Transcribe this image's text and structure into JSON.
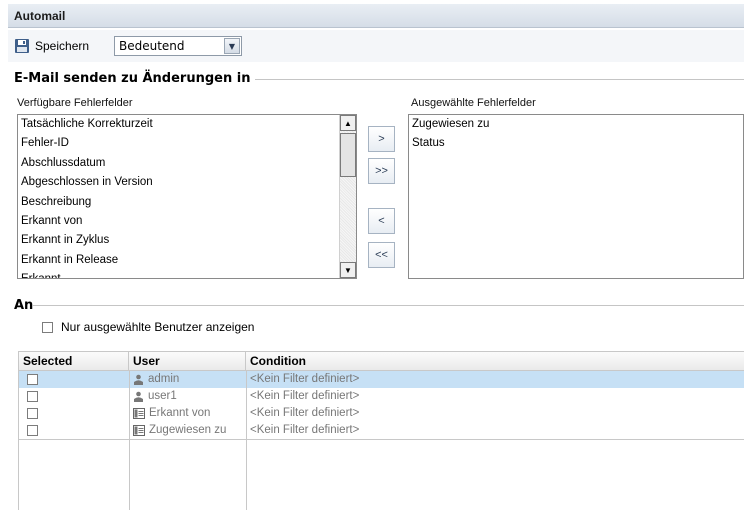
{
  "window": {
    "title": "Automail"
  },
  "toolbar": {
    "save_label": "Speichern",
    "save_icon": "floppy-disk-icon",
    "importance_select": {
      "selected": "Bedeutend"
    }
  },
  "send_section": {
    "title": "E-Mail senden zu Änderungen  in",
    "available_label": "Verfügbare Fehlerfelder",
    "available_fields": [
      "Tatsächliche Korrekturzeit",
      "Fehler-ID",
      "Abschlussdatum",
      "Abgeschlossen in Version",
      "Beschreibung",
      "Erkannt von",
      "Erkannt in Zyklus",
      "Erkannt in Release",
      "Erkannt..."
    ],
    "selected_label": "Ausgewählte Fehlerfelder",
    "selected_fields": [
      "Zugewiesen zu",
      "Status"
    ],
    "buttons": {
      "add": ">",
      "add_all": ">>",
      "remove": "<",
      "remove_all": "<<"
    }
  },
  "recipients_section": {
    "title": "An",
    "only_selected_label": "Nur ausgewählte Benutzer anzeigen",
    "table": {
      "headers": {
        "selected": "Selected",
        "user": "User",
        "condition": "Condition"
      },
      "rows": [
        {
          "user": "admin",
          "icon": "user-icon",
          "condition": "<Kein Filter definiert>",
          "highlighted": true
        },
        {
          "user": "user1",
          "icon": "user-icon",
          "condition": "<Kein Filter definiert>",
          "highlighted": false
        },
        {
          "user": "Erkannt von",
          "icon": "field-icon",
          "condition": "<Kein Filter definiert>",
          "highlighted": false
        },
        {
          "user": "Zugewiesen zu",
          "icon": "field-icon",
          "condition": "<Kein Filter definiert>",
          "highlighted": false
        }
      ]
    }
  },
  "colors": {
    "selection": "#c6e0f5",
    "title_bar": "#d5dde7"
  }
}
